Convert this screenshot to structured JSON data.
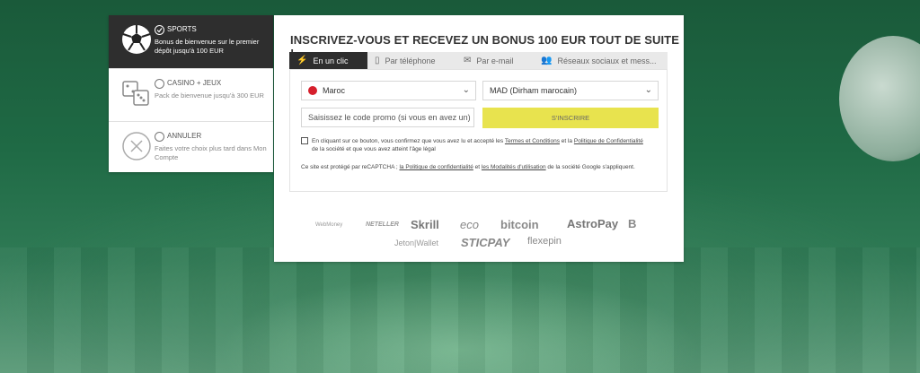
{
  "options": [
    {
      "title": "SPORTS",
      "desc": "Bonus de bienvenue sur le premier dépôt jusqu'à 100 EUR",
      "icon": "soccer-ball-icon",
      "active": true
    },
    {
      "title": "CASINO + JEUX",
      "desc": "Pack de bienvenue jusqu'à 300 EUR",
      "icon": "casino-dice-icon",
      "active": false
    },
    {
      "title": "ANNULER",
      "desc": "Faites votre choix plus tard dans Mon Compte",
      "icon": "cancel-x-icon",
      "active": false
    }
  ],
  "form": {
    "heading": "INSCRIVEZ-VOUS ET RECEVEZ UN BONUS 100 EUR TOUT DE SUITE !",
    "tabs": [
      {
        "label": "En un clic",
        "icon": "lightning-icon"
      },
      {
        "label": "Par téléphone",
        "icon": "phone-icon"
      },
      {
        "label": "Par e-mail",
        "icon": "envelope-icon"
      },
      {
        "label": "Réseaux sociaux et mess...",
        "icon": "people-icon"
      }
    ],
    "country": "Maroc",
    "currency": "MAD (Dirham marocain)",
    "promo_placeholder": "Saisissez le code promo (si vous en avez un)",
    "submit": "S'INSCRIRE",
    "legal_1": "En cliquant sur ce bouton, vous confirmez que vous avez lu et accepté les",
    "legal_terms": "Termes et Conditions",
    "legal_and": "et la",
    "legal_privacy": "Politique de Confidentialité",
    "legal_2": "de la société et que vous avez atteint l'âge légal",
    "recap_1": "Ce site est protégé par reCAPTCHA ;",
    "recap_privacy": "la Politique de confidentialité",
    "recap_and": "et",
    "recap_terms": "les Modalités d'utilisation",
    "recap_2": "de la société Google s'appliquent."
  },
  "logos": [
    "WebMoney",
    "NETELLER",
    "Skrill",
    "eco",
    "bitcoin",
    "AstroPay",
    "B",
    "Jeton|Wallet",
    "STICPAY",
    "flexepin"
  ],
  "colors": {
    "accent": "#e8e34e",
    "active_tab": "#2e2e2e",
    "background": "#1f6a45"
  }
}
